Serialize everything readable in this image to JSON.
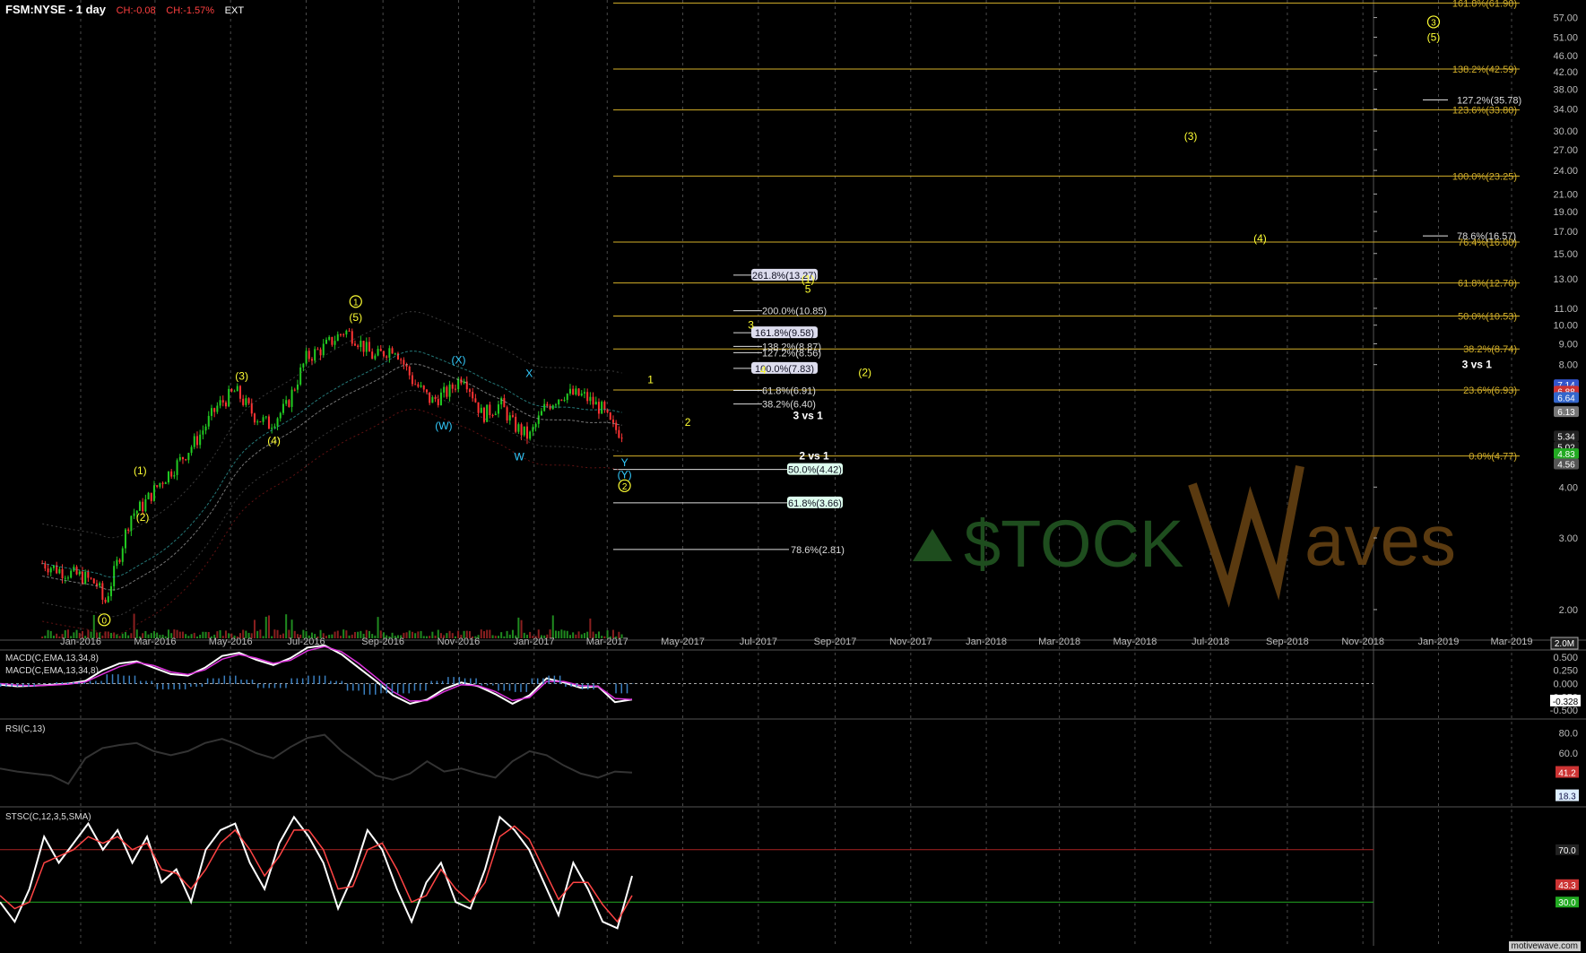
{
  "header": {
    "symbol": "FSM:NYSE - 1 day",
    "change_abs": "CH:-0.08",
    "change_pct": "CH:-1.57%",
    "session": "EXT"
  },
  "footer": {
    "source": "motivewave.com"
  },
  "colors": {
    "background": "#000000",
    "fib_line": "#d4b02a",
    "fib_line_white": "#e8e8e8",
    "wave_yellow": "#ffff33",
    "wave_cyan": "#33ccff",
    "up_candle": "#22cc22",
    "down_candle": "#ff3333",
    "macd": "#ffffff",
    "macd_signal": "#dd33dd",
    "stoch_k": "#ffffff",
    "stoch_d": "#ff4444",
    "watermark": "#1e4d1e",
    "watermark_brown": "#5a3a10"
  },
  "watermark": {
    "part1": "$TOCK",
    "part2": "aves"
  },
  "chart_data": [
    {
      "type": "line",
      "title": "FSM:NYSE - 1 day",
      "scale": "log",
      "x_ticks": [
        "Jan-2016",
        "Mar-2016",
        "May-2016",
        "Jul-2016",
        "Sep-2016",
        "Nov-2016",
        "Jan-2017",
        "Mar-2017",
        "May-2017",
        "Jul-2017",
        "Sep-2017",
        "Nov-2017",
        "Jan-2018",
        "Mar-2018",
        "May-2018",
        "Jul-2018",
        "Sep-2018",
        "Nov-2018",
        "Jan-2019",
        "Mar-2019"
      ],
      "y_ticks": [
        "57.00",
        "51.00",
        "46.00",
        "42.00",
        "38.00",
        "34.00",
        "30.00",
        "27.00",
        "24.00",
        "21.00",
        "19.00",
        "17.00",
        "15.00",
        "13.00",
        "11.00",
        "10.00",
        "9.00",
        "8.00",
        "4.00",
        "3.00",
        "2.00"
      ],
      "ylim": [
        1.7,
        62
      ],
      "grid": true,
      "price_series": {
        "name": "FSM",
        "dates": [
          "2015-12-01",
          "2015-12-15",
          "2016-01-04",
          "2016-01-15",
          "2016-01-20",
          "2016-02-01",
          "2016-02-10",
          "2016-02-20",
          "2016-03-05",
          "2016-03-20",
          "2016-04-05",
          "2016-04-20",
          "2016-05-05",
          "2016-05-20",
          "2016-06-01",
          "2016-06-15",
          "2016-07-01",
          "2016-07-15",
          "2016-08-01",
          "2016-08-10",
          "2016-08-25",
          "2016-09-10",
          "2016-09-25",
          "2016-10-10",
          "2016-10-25",
          "2016-11-05",
          "2016-11-20",
          "2016-12-05",
          "2016-12-15",
          "2016-12-28",
          "2017-01-10",
          "2017-01-25",
          "2017-02-10",
          "2017-02-25",
          "2017-03-05",
          "2017-03-15"
        ],
        "close": [
          2.6,
          2.5,
          2.4,
          2.3,
          2.05,
          2.7,
          3.4,
          3.6,
          4.1,
          4.6,
          5.3,
          6.3,
          6.9,
          6.0,
          5.7,
          6.3,
          8.3,
          8.8,
          9.7,
          9.3,
          8.3,
          8.9,
          7.3,
          6.5,
          6.9,
          7.6,
          6.0,
          6.4,
          5.7,
          5.3,
          6.3,
          6.8,
          6.7,
          6.2,
          5.6,
          5.4
        ]
      },
      "volume_label": "2.0M",
      "price_badges": [
        {
          "label": "7.14",
          "color": "#3355cc"
        },
        {
          "label": "6.88",
          "color": "#cc3333"
        },
        {
          "label": "6.64",
          "color": "#3366cc"
        },
        {
          "label": "6.13",
          "color": "#777777"
        },
        {
          "label": "5.34",
          "color": "#222222"
        },
        {
          "label": "5.02",
          "color": "#222222"
        },
        {
          "label": "4.83",
          "color": "#22aa22"
        },
        {
          "label": "4.56",
          "color": "#555555"
        }
      ],
      "fib_right": [
        {
          "label": "161.8%(61.90)",
          "price": 61.9
        },
        {
          "label": "138.2%(42.59)",
          "price": 42.59
        },
        {
          "label": "123.6%(33.80)",
          "price": 33.8
        },
        {
          "label": "100.0%(23.25)",
          "price": 23.25
        },
        {
          "label": "76.4%(16.00)",
          "price": 16.0
        },
        {
          "label": "61.8%(12.70)",
          "price": 12.7
        },
        {
          "label": "50.0%(10.53)",
          "price": 10.53
        },
        {
          "label": "38.2%(8.74)",
          "price": 8.74
        },
        {
          "label": "23.6%(6.93)",
          "price": 6.93
        },
        {
          "label": "0.0%(4.77)",
          "price": 4.77
        }
      ],
      "fib_white_right": [
        {
          "label": "127.2%(35.78)",
          "price": 35.78
        },
        {
          "label": "78.6%(16.57)",
          "price": 16.57
        }
      ],
      "fib_mid": [
        {
          "label": "261.8%(13.27)",
          "price": 13.27,
          "boxed": true
        },
        {
          "label": "200.0%(10.85)",
          "price": 10.85,
          "boxed": false
        },
        {
          "label": "161.8%(9.58)",
          "price": 9.58,
          "boxed": true
        },
        {
          "label": "138.2%(8.87)",
          "price": 8.87,
          "boxed": false
        },
        {
          "label": "127.2%(8.56)",
          "price": 8.56,
          "boxed": false
        },
        {
          "label": "100.0%(7.83)",
          "price": 7.83,
          "boxed": true
        },
        {
          "label": "61.8%(6.91)",
          "price": 6.91,
          "boxed": false
        },
        {
          "label": "38.2%(6.40)",
          "price": 6.4,
          "boxed": false
        }
      ],
      "fib_low": [
        {
          "label": "50.0%(4.42)",
          "price": 4.42,
          "boxed": true
        },
        {
          "label": "61.8%(3.66)",
          "price": 3.66,
          "boxed": true
        },
        {
          "label": "78.6%(2.81)",
          "price": 2.81,
          "boxed": false
        }
      ],
      "wave_labels": [
        {
          "text": "0",
          "date": "2016-01-20",
          "price": 1.85,
          "color": "yellow",
          "circled": true
        },
        {
          "text": "(1)",
          "date": "2016-02-18",
          "price": 4.3,
          "color": "yellow"
        },
        {
          "text": "(2)",
          "date": "2016-02-20",
          "price": 3.3,
          "color": "yellow"
        },
        {
          "text": "(3)",
          "date": "2016-05-10",
          "price": 7.35,
          "color": "yellow"
        },
        {
          "text": "(4)",
          "date": "2016-06-05",
          "price": 5.1,
          "color": "yellow"
        },
        {
          "text": "1",
          "date": "2016-08-10",
          "price": 11.2,
          "color": "yellow",
          "circled": true
        },
        {
          "text": "(5)",
          "date": "2016-08-10",
          "price": 10.25,
          "color": "yellow"
        },
        {
          "text": "(X)",
          "date": "2016-11-01",
          "price": 8.05,
          "color": "cyan"
        },
        {
          "text": "(W)",
          "date": "2016-10-20",
          "price": 5.55,
          "color": "cyan"
        },
        {
          "text": "X",
          "date": "2016-12-28",
          "price": 7.45,
          "color": "cyan"
        },
        {
          "text": "W",
          "date": "2016-12-20",
          "price": 4.65,
          "color": "cyan"
        },
        {
          "text": "Y",
          "date": "2017-03-15",
          "price": 4.5,
          "color": "cyan"
        },
        {
          "text": "(Y)",
          "date": "2017-03-15",
          "price": 4.2,
          "color": "cyan"
        },
        {
          "text": "2",
          "date": "2017-03-15",
          "price": 3.95,
          "color": "yellow",
          "circled": true
        },
        {
          "text": "1",
          "date": "2017-04-05",
          "price": 7.2,
          "color": "yellow"
        },
        {
          "text": "2",
          "date": "2017-05-05",
          "price": 5.65,
          "color": "yellow"
        },
        {
          "text": "3",
          "date": "2017-06-25",
          "price": 9.8,
          "color": "yellow"
        },
        {
          "text": "4",
          "date": "2017-07-05",
          "price": 7.6,
          "color": "yellow"
        },
        {
          "text": "5",
          "date": "2017-08-10",
          "price": 12.0,
          "color": "yellow"
        },
        {
          "text": "(1)",
          "date": "2017-08-10",
          "price": 12.7,
          "color": "yellow"
        },
        {
          "text": "(2)",
          "date": "2017-09-25",
          "price": 7.5,
          "color": "yellow"
        },
        {
          "text": "(3)",
          "date": "2018-06-15",
          "price": 28.5,
          "color": "yellow"
        },
        {
          "text": "(4)",
          "date": "2018-08-10",
          "price": 16.0,
          "color": "yellow"
        },
        {
          "text": "3",
          "date": "2018-12-28",
          "price": 54.5,
          "color": "yellow",
          "circled": true
        },
        {
          "text": "(5)",
          "date": "2018-12-28",
          "price": 50.0,
          "color": "yellow"
        }
      ],
      "text_labels": [
        {
          "text": "3 vs 1",
          "date": "2017-08-10",
          "price": 6.0,
          "color": "white"
        },
        {
          "text": "2 vs 1",
          "date": "2017-08-15",
          "price": 4.77,
          "color": "white"
        },
        {
          "text": "3 vs 1",
          "date": "2019-02-01",
          "price": 8.0,
          "color": "white"
        }
      ]
    },
    {
      "type": "line",
      "title": "MACD(C,EMA,13,34,8)",
      "labels": [
        "MACD(C,EMA,13,34,8)",
        "MACD(C,EMA,13,34,8)"
      ],
      "y_ticks": [
        "0.500",
        "0.250",
        "0.000",
        "-0.250",
        "-0.500"
      ],
      "ylim": [
        -0.6,
        0.6
      ],
      "current": "-0.328",
      "series": [
        {
          "name": "MACD",
          "values": [
            -0.02,
            -0.05,
            -0.04,
            -0.02,
            0.0,
            0.05,
            0.25,
            0.38,
            0.42,
            0.3,
            0.18,
            0.15,
            0.3,
            0.52,
            0.58,
            0.45,
            0.35,
            0.48,
            0.68,
            0.72,
            0.55,
            0.3,
            0.05,
            -0.22,
            -0.38,
            -0.3,
            -0.1,
            0.02,
            -0.05,
            -0.2,
            -0.38,
            -0.22,
            0.1,
            0.02,
            -0.08,
            -0.05,
            -0.35,
            -0.3
          ]
        },
        {
          "name": "Signal",
          "values": [
            0.0,
            -0.03,
            -0.04,
            -0.03,
            -0.01,
            0.03,
            0.18,
            0.32,
            0.4,
            0.34,
            0.22,
            0.17,
            0.26,
            0.46,
            0.55,
            0.48,
            0.38,
            0.44,
            0.62,
            0.7,
            0.6,
            0.38,
            0.12,
            -0.15,
            -0.33,
            -0.32,
            -0.15,
            -0.02,
            -0.04,
            -0.15,
            -0.32,
            -0.26,
            0.04,
            0.04,
            -0.04,
            -0.05,
            -0.28,
            -0.3
          ]
        }
      ]
    },
    {
      "type": "line",
      "title": "RSI(C,13)",
      "y_ticks": [
        "80.0",
        "60.0",
        "40.0",
        "20.0"
      ],
      "ylim": [
        10,
        90
      ],
      "current": [
        "41.2",
        "18.3"
      ],
      "series": [
        {
          "name": "RSI",
          "values": [
            45,
            42,
            40,
            38,
            30,
            55,
            65,
            68,
            70,
            62,
            58,
            62,
            70,
            74,
            68,
            60,
            55,
            66,
            75,
            78,
            62,
            50,
            38,
            34,
            40,
            52,
            42,
            45,
            40,
            36,
            52,
            62,
            58,
            48,
            40,
            36,
            42,
            41
          ]
        }
      ]
    },
    {
      "type": "line",
      "title": "STSC(C,12,3,5,SMA)",
      "y_ticks": [
        "70.0",
        "30.0"
      ],
      "ylim": [
        0,
        100
      ],
      "current": [
        "70.0",
        "43.3",
        "30.0"
      ],
      "series": [
        {
          "name": "%K",
          "values": [
            30,
            15,
            40,
            80,
            60,
            75,
            90,
            70,
            85,
            60,
            80,
            45,
            55,
            30,
            70,
            85,
            90,
            60,
            40,
            75,
            95,
            80,
            60,
            25,
            50,
            85,
            70,
            40,
            15,
            45,
            60,
            30,
            25,
            55,
            95,
            85,
            70,
            45,
            20,
            60,
            40,
            15,
            10,
            50
          ]
        },
        {
          "name": "%D",
          "values": [
            35,
            25,
            30,
            60,
            65,
            70,
            80,
            75,
            80,
            70,
            75,
            55,
            52,
            40,
            55,
            75,
            85,
            70,
            50,
            65,
            85,
            85,
            70,
            40,
            42,
            70,
            75,
            55,
            30,
            35,
            55,
            40,
            30,
            45,
            80,
            88,
            78,
            55,
            32,
            45,
            45,
            28,
            15,
            35
          ]
        }
      ]
    }
  ]
}
